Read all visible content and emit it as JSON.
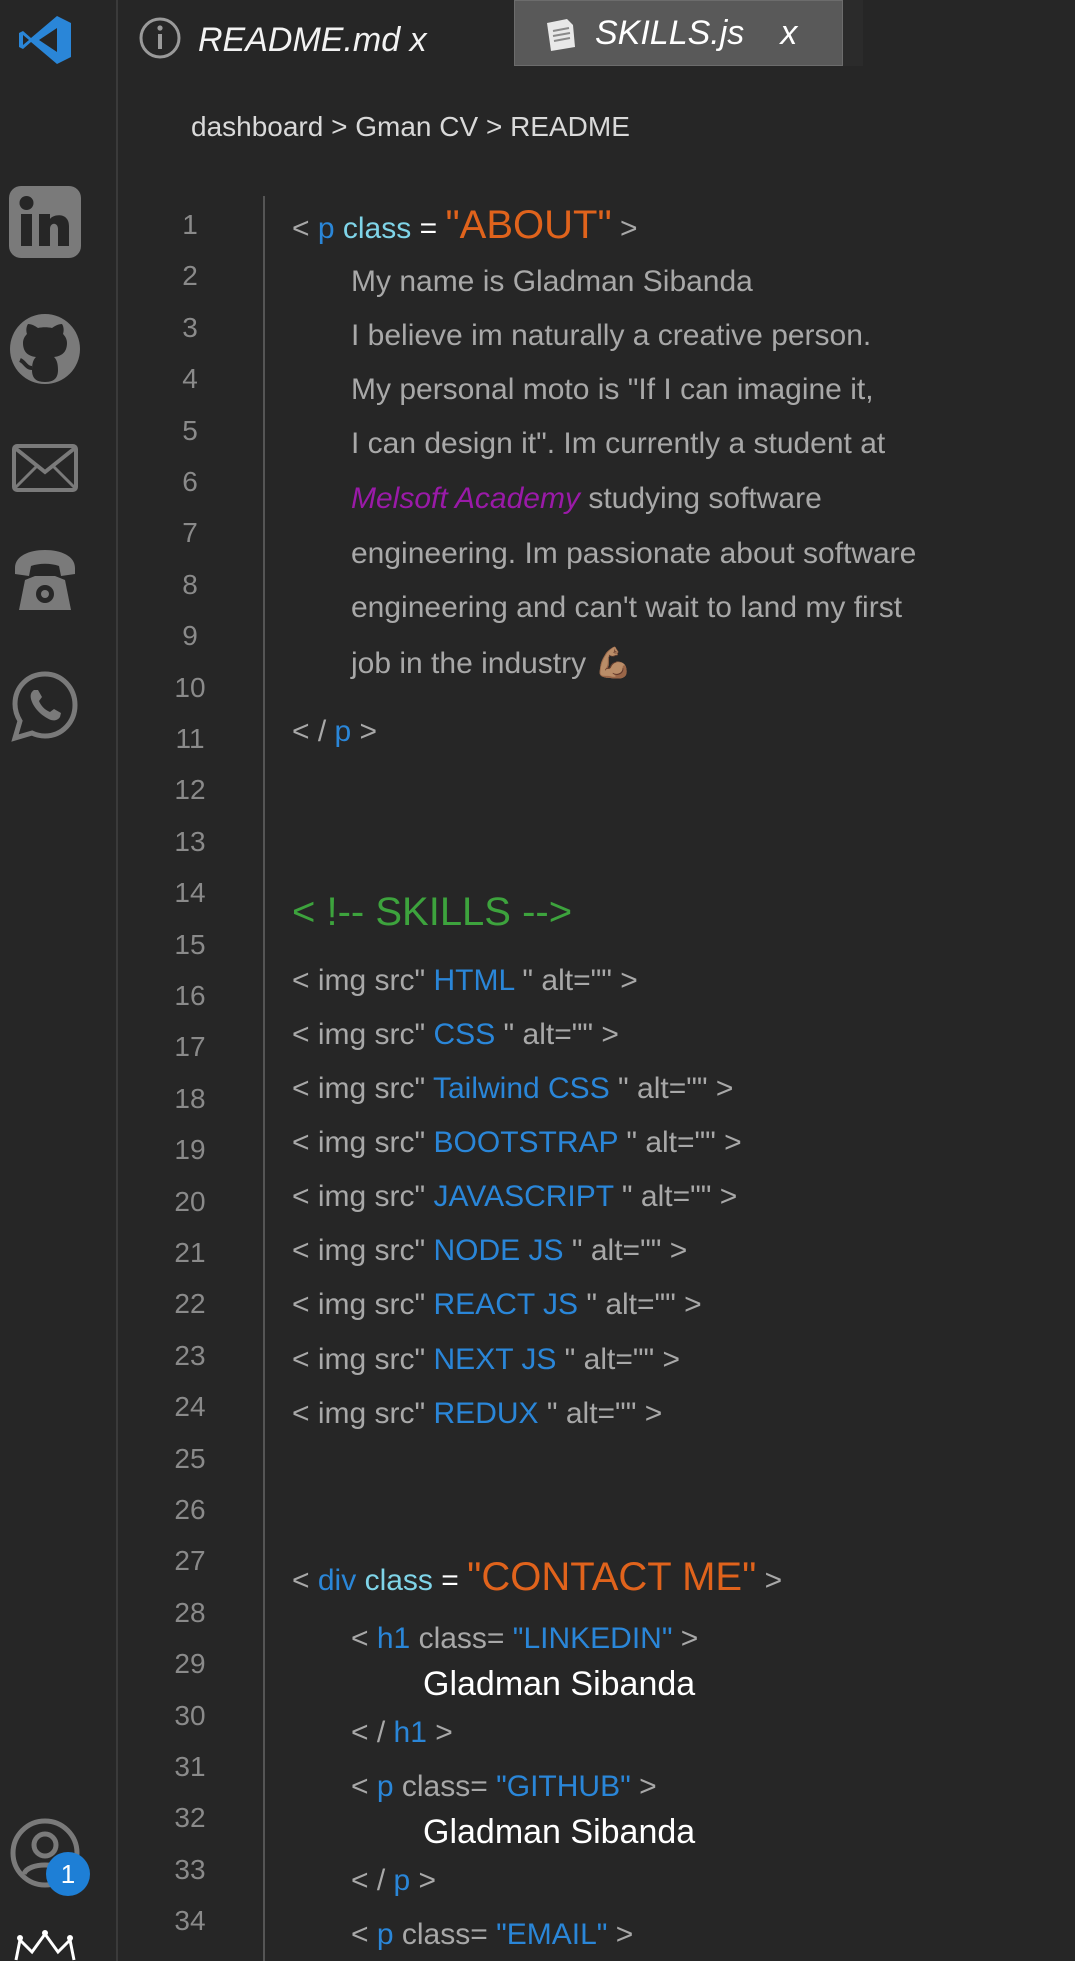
{
  "tabs": [
    {
      "label": "README.md x"
    },
    {
      "label": "SKILLS.js",
      "close": "x"
    }
  ],
  "breadcrumb": "dashboard > Gman CV > README",
  "activity": {
    "icons": [
      "vscode-logo-icon",
      "linkedin-icon",
      "github-icon",
      "mail-icon",
      "phone-icon",
      "whatsapp-icon",
      "account-icon",
      "crown-icon"
    ],
    "notification_count": "1"
  },
  "line_numbers": [
    "1",
    "2",
    "3",
    "4",
    "5",
    "6",
    "7",
    "8",
    "9",
    "10",
    "11",
    "12",
    "13",
    "14",
    "15",
    "16",
    "17",
    "18",
    "19",
    "20",
    "21",
    "22",
    "23",
    "24",
    "25",
    "26",
    "27",
    "28",
    "29",
    "30",
    "31",
    "32",
    "33",
    "34"
  ],
  "about": {
    "tag": "p",
    "attr": "class",
    "value": "\"ABOUT\"",
    "lines": [
      "My name is Gladman Sibanda",
      "I believe im naturally a creative person.",
      "My personal moto is \"If I can imagine it,",
      "I can design it\". Im currently a student at"
    ],
    "academy": "Melsoft Academy",
    "line6_rest": " studying software",
    "lines2": [
      "engineering. Im passionate about software",
      "engineering and can't wait to land my first",
      "job in the industry 💪🏽"
    ]
  },
  "skills": {
    "comment": "< !-- SKILLS -->",
    "prefix": "< img src\"",
    "suffix": " \" alt=\"\" >",
    "items": [
      "HTML",
      "CSS",
      "Tailwind CSS",
      "BOOTSTRAP",
      "JAVASCRIPT",
      "NODE JS",
      "REACT JS",
      "NEXT JS",
      "REDUX"
    ]
  },
  "contact": {
    "tag": "div",
    "attr": "class",
    "value": "\"CONTACT ME\"",
    "linkedin": {
      "tag": "h1",
      "attr": "class=",
      "value": "\"LINKEDIN\"",
      "text": "Gladman Sibanda"
    },
    "github": {
      "tag": "p",
      "attr": "class=",
      "value": "\"GITHUB\"",
      "text": "Gladman Sibanda"
    },
    "email": {
      "tag": "p",
      "attr": "class=",
      "value": "\"EMAIL\""
    }
  },
  "colors": {
    "background": "#262626",
    "tag": "#2a86d8",
    "attribute": "#7fd4e8",
    "string": "#e0631c",
    "comment": "#3da33d",
    "highlight": "#9a1aa8",
    "badge": "#1e7fd6"
  }
}
